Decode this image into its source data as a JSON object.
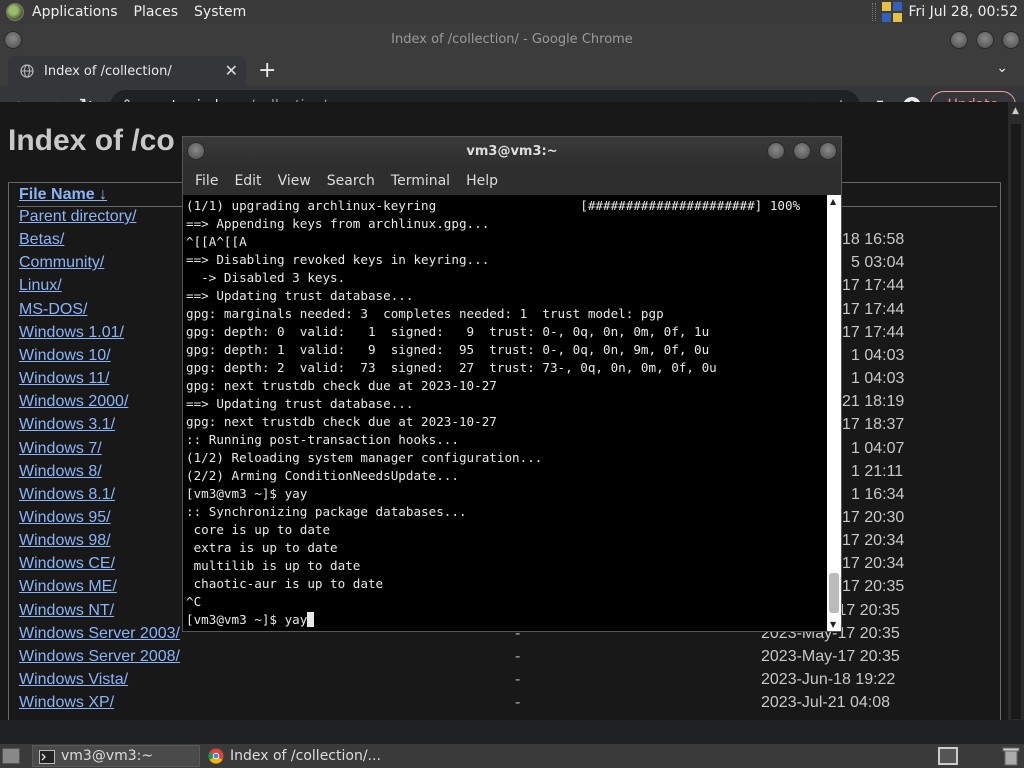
{
  "panel": {
    "menus": [
      "Applications",
      "Places",
      "System"
    ],
    "clock": "Fri Jul 28, 00:52"
  },
  "chrome": {
    "window_title": "Index of /collection/ - Google Chrome",
    "tab_title": "Index of /collection/",
    "url_host": "crustywindo.ws",
    "url_path": "/collection/",
    "update_label": "Update"
  },
  "page": {
    "title": "Index of /co",
    "column_name": "File Name  ↓",
    "rows": [
      {
        "name": "Parent directory/",
        "size": "",
        "date": ""
      },
      {
        "name": "Betas/",
        "size": "",
        "date": "18 16:58"
      },
      {
        "name": "Community/",
        "size": "",
        "date": "5 03:04"
      },
      {
        "name": "Linux/",
        "size": "",
        "date": "17 17:44"
      },
      {
        "name": "MS-DOS/",
        "size": "",
        "date": "17 17:44"
      },
      {
        "name": "Windows 1.01/",
        "size": "",
        "date": "17 17:44"
      },
      {
        "name": "Windows 10/",
        "size": "",
        "date": "1 04:03"
      },
      {
        "name": "Windows 11/",
        "size": "",
        "date": "1 04:03"
      },
      {
        "name": "Windows 2000/",
        "size": "",
        "date": "21 18:19"
      },
      {
        "name": "Windows 3.1/",
        "size": "",
        "date": "17 18:37"
      },
      {
        "name": "Windows 7/",
        "size": "",
        "date": "1 04:07"
      },
      {
        "name": "Windows 8/",
        "size": "",
        "date": "1 21:11"
      },
      {
        "name": "Windows 8.1/",
        "size": "",
        "date": "1 16:34"
      },
      {
        "name": "Windows 95/",
        "size": "",
        "date": "17 20:30"
      },
      {
        "name": "Windows 98/",
        "size": "",
        "date": "17 20:34"
      },
      {
        "name": "Windows CE/",
        "size": "",
        "date": "17 20:34"
      },
      {
        "name": "Windows ME/",
        "size": "",
        "date": "17 20:35"
      },
      {
        "name": "Windows NT/",
        "size": "-",
        "date": "2023-May-17 20:35"
      },
      {
        "name": "Windows Server 2003/",
        "size": "-",
        "date": "2023-May-17 20:35"
      },
      {
        "name": "Windows Server 2008/",
        "size": "-",
        "date": "2023-May-17 20:35"
      },
      {
        "name": "Windows Vista/",
        "size": "-",
        "date": "2023-Jun-18 19:22"
      },
      {
        "name": "Windows XP/",
        "size": "-",
        "date": "2023-Jul-21 04:08"
      }
    ]
  },
  "terminal": {
    "title": "vm3@vm3:~",
    "menus": [
      "File",
      "Edit",
      "View",
      "Search",
      "Terminal",
      "Help"
    ],
    "lines": [
      "(1/1) upgrading archlinux-keyring                   [######################] 100%",
      "==> Appending keys from archlinux.gpg...",
      "^[[A^[[A",
      "==> Disabling revoked keys in keyring...",
      "  -> Disabled 3 keys.",
      "==> Updating trust database...",
      "gpg: marginals needed: 3  completes needed: 1  trust model: pgp",
      "gpg: depth: 0  valid:   1  signed:   9  trust: 0-, 0q, 0n, 0m, 0f, 1u",
      "gpg: depth: 1  valid:   9  signed:  95  trust: 0-, 0q, 0n, 9m, 0f, 0u",
      "gpg: depth: 2  valid:  73  signed:  27  trust: 73-, 0q, 0n, 0m, 0f, 0u",
      "gpg: next trustdb check due at 2023-10-27",
      "==> Updating trust database...",
      "gpg: next trustdb check due at 2023-10-27",
      ":: Running post-transaction hooks...",
      "(1/2) Reloading system manager configuration...",
      "(2/2) Arming ConditionNeedsUpdate...",
      "[vm3@vm3 ~]$ yay",
      ":: Synchronizing package databases...",
      " core is up to date",
      " extra is up to date",
      " multilib is up to date",
      " chaotic-aur is up to date",
      "^C"
    ],
    "prompt": "[vm3@vm3 ~]$ yay"
  },
  "taskbar": {
    "tasks": [
      "vm3@vm3:~",
      "Index of /collection/..."
    ]
  },
  "colors": {
    "link": "#8ab4f8",
    "update_accent": "#f28b82"
  }
}
